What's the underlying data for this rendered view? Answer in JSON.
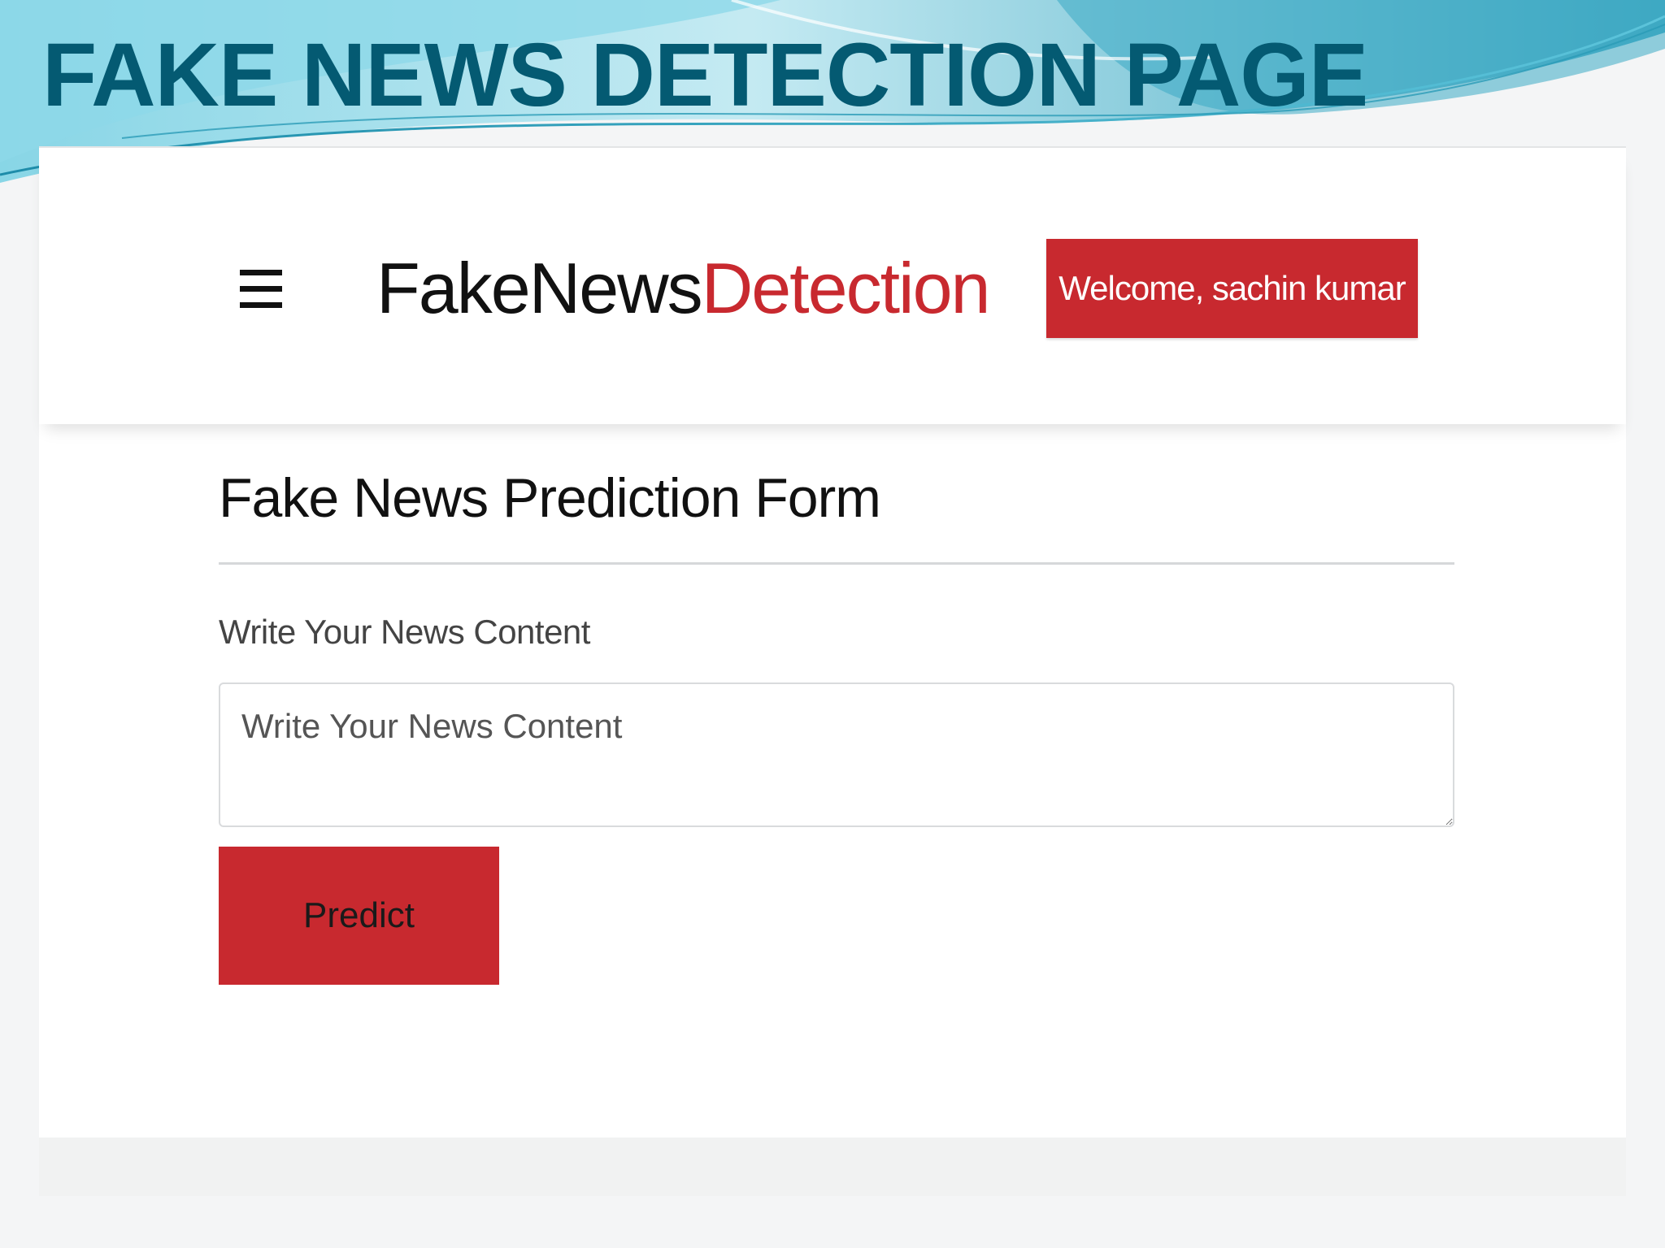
{
  "slide": {
    "title": "FAKE NEWS DETECTION PAGE"
  },
  "colors": {
    "title": "#045a72",
    "accent_red": "#c8292f",
    "wave_light": "#8fd6e6",
    "wave_dark": "#2a9bb6"
  },
  "navbar": {
    "menu_icon": "hamburger-menu-icon",
    "brand_part1": "FakeNews",
    "brand_part2": "Detection",
    "welcome_label": "Welcome, sachin kumar"
  },
  "form": {
    "title": "Fake News Prediction Form",
    "field_label": "Write Your News Content",
    "field_placeholder": "Write Your News Content",
    "field_value": "",
    "submit_label": "Predict"
  }
}
